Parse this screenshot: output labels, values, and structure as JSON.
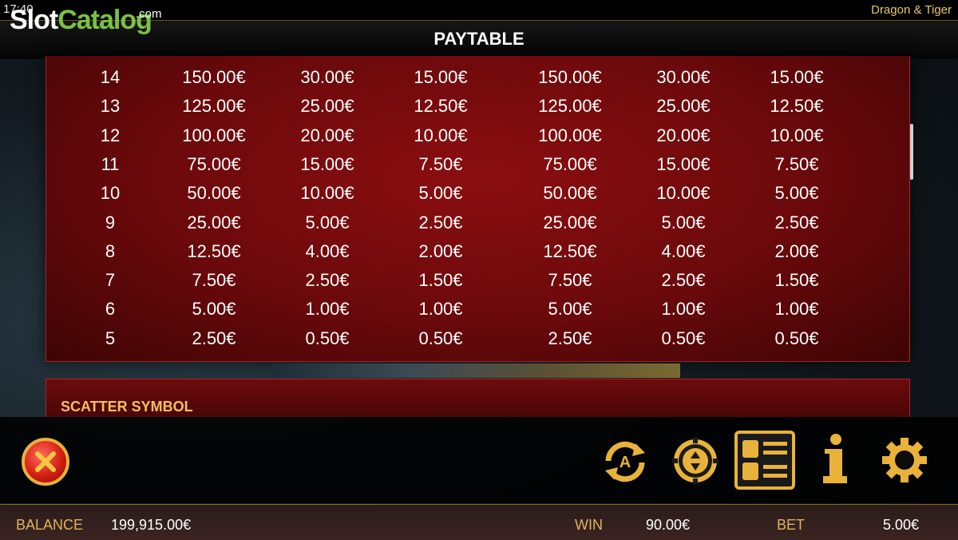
{
  "status": {
    "time": "17:40",
    "game_title": "Dragon & Tiger"
  },
  "watermark": {
    "part1": "Slot",
    "part2": "Catalog",
    "part3": ".com"
  },
  "header": {
    "title": "PAYTABLE"
  },
  "paytable": {
    "rows": [
      {
        "count": "14",
        "values": [
          "150.00€",
          "30.00€",
          "15.00€",
          "150.00€",
          "30.00€",
          "15.00€"
        ]
      },
      {
        "count": "13",
        "values": [
          "125.00€",
          "25.00€",
          "12.50€",
          "125.00€",
          "25.00€",
          "12.50€"
        ]
      },
      {
        "count": "12",
        "values": [
          "100.00€",
          "20.00€",
          "10.00€",
          "100.00€",
          "20.00€",
          "10.00€"
        ]
      },
      {
        "count": "11",
        "values": [
          "75.00€",
          "15.00€",
          "7.50€",
          "75.00€",
          "15.00€",
          "7.50€"
        ]
      },
      {
        "count": "10",
        "values": [
          "50.00€",
          "10.00€",
          "5.00€",
          "50.00€",
          "10.00€",
          "5.00€"
        ]
      },
      {
        "count": "9",
        "values": [
          "25.00€",
          "5.00€",
          "2.50€",
          "25.00€",
          "5.00€",
          "2.50€"
        ]
      },
      {
        "count": "8",
        "values": [
          "12.50€",
          "4.00€",
          "2.00€",
          "12.50€",
          "4.00€",
          "2.00€"
        ]
      },
      {
        "count": "7",
        "values": [
          "7.50€",
          "2.50€",
          "1.50€",
          "7.50€",
          "2.50€",
          "1.50€"
        ]
      },
      {
        "count": "6",
        "values": [
          "5.00€",
          "1.00€",
          "1.00€",
          "5.00€",
          "1.00€",
          "1.00€"
        ]
      },
      {
        "count": "5",
        "values": [
          "2.50€",
          "0.50€",
          "0.50€",
          "2.50€",
          "0.50€",
          "0.50€"
        ]
      }
    ]
  },
  "scatter": {
    "title": "SCATTER SYMBOL"
  },
  "controls": {
    "icons": [
      "close-icon",
      "autoplay-icon",
      "bet-chip-icon",
      "paytable-icon",
      "info-icon",
      "gear-icon"
    ],
    "autoplay_letter": "A",
    "accent": "#e9b23a"
  },
  "bottom_bar": {
    "balance_label": "BALANCE",
    "balance_value": "199,915.00€",
    "win_label": "WIN",
    "win_value": "90.00€",
    "bet_label": "BET",
    "bet_value": "5.00€"
  }
}
